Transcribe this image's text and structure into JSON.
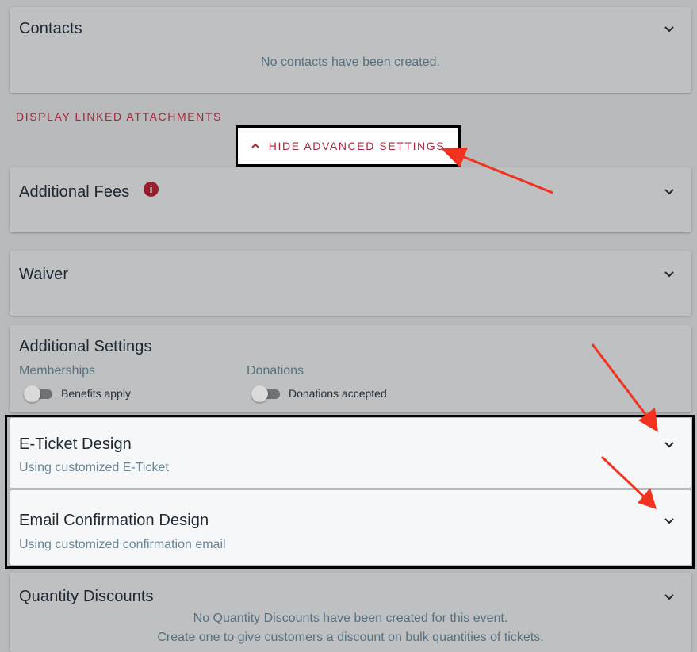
{
  "contacts": {
    "title": "Contacts",
    "empty_text": "No contacts have been created."
  },
  "display_linked_attachments": "DISPLAY LINKED ATTACHMENTS",
  "advanced": {
    "toggle_label": "HIDE ADVANCED SETTINGS"
  },
  "additional_fees": {
    "title": "Additional Fees",
    "info_glyph": "i"
  },
  "waiver": {
    "title": "Waiver"
  },
  "additional_settings": {
    "title": "Additional Settings",
    "memberships": {
      "label": "Memberships",
      "toggle_label": "Benefits apply",
      "on": false
    },
    "donations": {
      "label": "Donations",
      "toggle_label": "Donations accepted",
      "on": false
    }
  },
  "eticket": {
    "title": "E-Ticket Design",
    "subtitle": "Using customized E-Ticket"
  },
  "email_confirmation": {
    "title": "Email Confirmation Design",
    "subtitle": "Using customized confirmation email"
  },
  "quantity_discounts": {
    "title": "Quantity Discounts",
    "line1": "No Quantity Discounts have been created for this event.",
    "line2": "Create one to give customers a discount on bulk quantities of tickets."
  },
  "colors": {
    "accent_red": "#a4283b",
    "annotation_arrow": "#f0321e",
    "overlay_gray": "#b8b9ba",
    "highlight_panel": "#f6f7f9"
  },
  "icons": [
    "chevron-down-icon",
    "chevron-up-icon",
    "info-icon",
    "annotation-arrow"
  ]
}
